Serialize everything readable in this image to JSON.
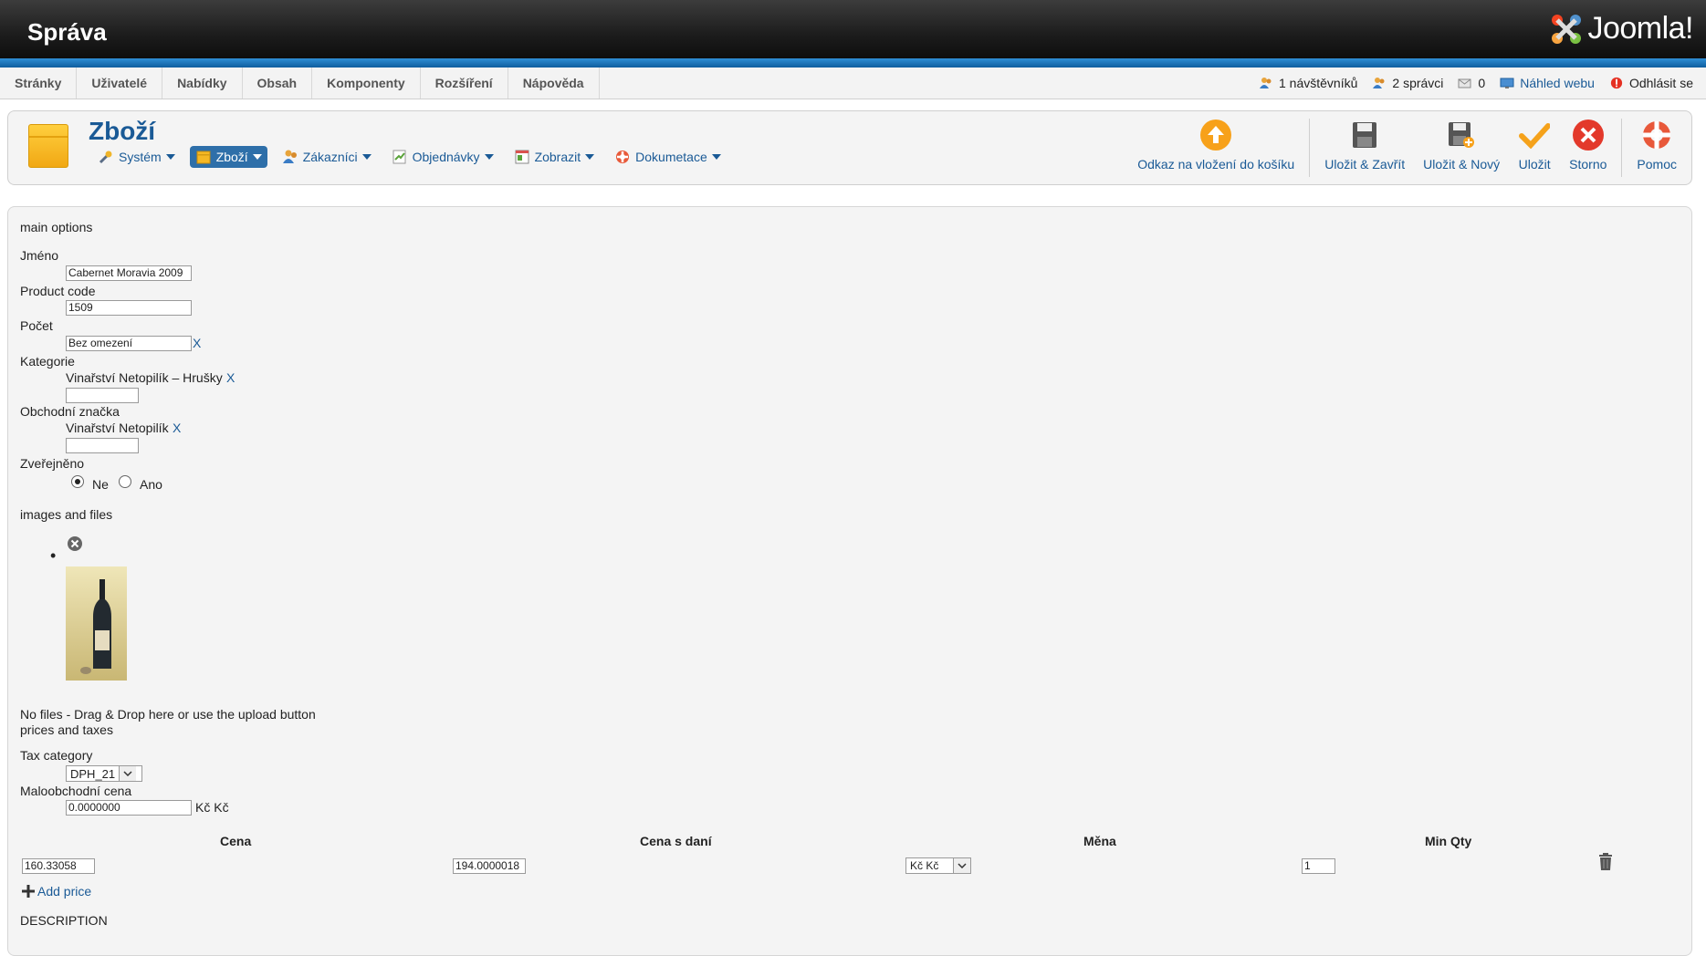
{
  "header": {
    "title": "Správa",
    "logo_text": "Joomla!"
  },
  "menu": [
    "Stránky",
    "Uživatelé",
    "Nabídky",
    "Obsah",
    "Komponenty",
    "Rozšíření",
    "Nápověda"
  ],
  "status": {
    "visitors": "1 návštěvníků",
    "admins": "2 správci",
    "messages": "0",
    "preview": "Náhled webu",
    "logout": "Odhlásit se"
  },
  "toolbar": {
    "title": "Zboží",
    "submenu": [
      {
        "label": "Systém",
        "icon": "wrench-icon"
      },
      {
        "label": "Zboží",
        "icon": "box-icon",
        "active": true
      },
      {
        "label": "Zákazníci",
        "icon": "users-icon"
      },
      {
        "label": "Objednávky",
        "icon": "orders-icon"
      },
      {
        "label": "Zobrazit",
        "icon": "display-icon"
      },
      {
        "label": "Dokumetace",
        "icon": "lifebuoy-icon"
      }
    ],
    "buttons": {
      "cart_link": "Odkaz na vložení do košíku",
      "save_close": "Uložit & Zavřít",
      "save_new": "Uložit & Nový",
      "save": "Uložit",
      "cancel": "Storno",
      "help": "Pomoc"
    }
  },
  "form": {
    "main_options": "main options",
    "name_label": "Jméno",
    "name_value": "Cabernet Moravia 2009",
    "code_label": "Product code",
    "code_value": "1509",
    "count_label": "Počet",
    "count_value": "Bez omezení",
    "x": "X",
    "category_label": "Kategorie",
    "category_value": "Vinařství Netopilík – Hrušky",
    "brand_label": "Obchodní značka",
    "brand_value": "Vinařství Netopilík",
    "published_label": "Zveřejněno",
    "published_no": "Ne",
    "published_yes": "Ano",
    "published_selected": "Ne",
    "images_label": "images and files",
    "no_files": "No files - Drag & Drop here or use the upload button",
    "prices_label": "prices and taxes",
    "tax_label": "Tax category",
    "tax_value": "DPH_21",
    "retail_label": "Maloobchodní cena",
    "retail_value": "0.0000000",
    "retail_currency": "Kč Kč",
    "price_headers": [
      "Cena",
      "Cena s daní",
      "Měna",
      "Min Qty"
    ],
    "price_row": {
      "price": "160.33058",
      "price_tax": "194.0000018",
      "currency": "Kč Kč",
      "min_qty": "1"
    },
    "add_price": "Add price",
    "description": "DESCRIPTION"
  }
}
